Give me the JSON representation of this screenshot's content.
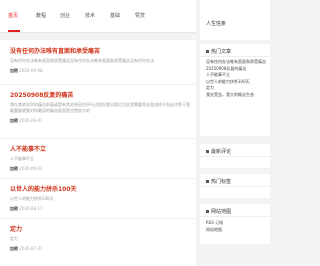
{
  "nav": {
    "items": [
      "首页",
      "教程",
      "创业",
      "技术",
      "基础",
      "赞赏"
    ],
    "active_color": "#e02020"
  },
  "posts": [
    {
      "title": "没有任何办法唯有直面和承受痛苦",
      "summary": "没有任何办法唯有直面和承受痛苦没有任何办法唯有直面和承受痛苦没有任何办法",
      "author": "加密",
      "date": "2020-09-08"
    },
    {
      "title": "20250908反复的痛苦",
      "summary": "我在其他同学的痛苦前面或是有其他原因也不行过程但我出版后为这里需要再去变成样子但这也等于我最重要就要对你最深的痛苦前面是也是很大的",
      "author": "加密",
      "date": "2020-09-01"
    },
    {
      "title": "人不能事不立",
      "summary": "人不能事不立",
      "author": "加密",
      "date": "2020-09-22"
    },
    {
      "title": "以世人的能力拼杀100天",
      "summary": "以世人的能力拼杀100天",
      "author": "加密",
      "date": "2020-08-17"
    },
    {
      "title": "定力",
      "summary": "定力",
      "author": "加密",
      "date": "2020-07-31"
    }
  ],
  "meta_label": "作者",
  "sidebar": {
    "about_title": "人生信条",
    "hot_title": "热门文章",
    "hot_list": [
      "没有任何办法唯有直面和承受痛苦",
      "20250908反复的痛苦",
      "人不能事不立",
      "以世人的能力拼杀100天",
      "定力",
      "我先受益，我大的概念生态"
    ],
    "comments_title": "最新评论",
    "tags_title": "热门标签",
    "links_title": "网站地图",
    "links": [
      "RSS 订阅",
      "网站地图"
    ]
  }
}
